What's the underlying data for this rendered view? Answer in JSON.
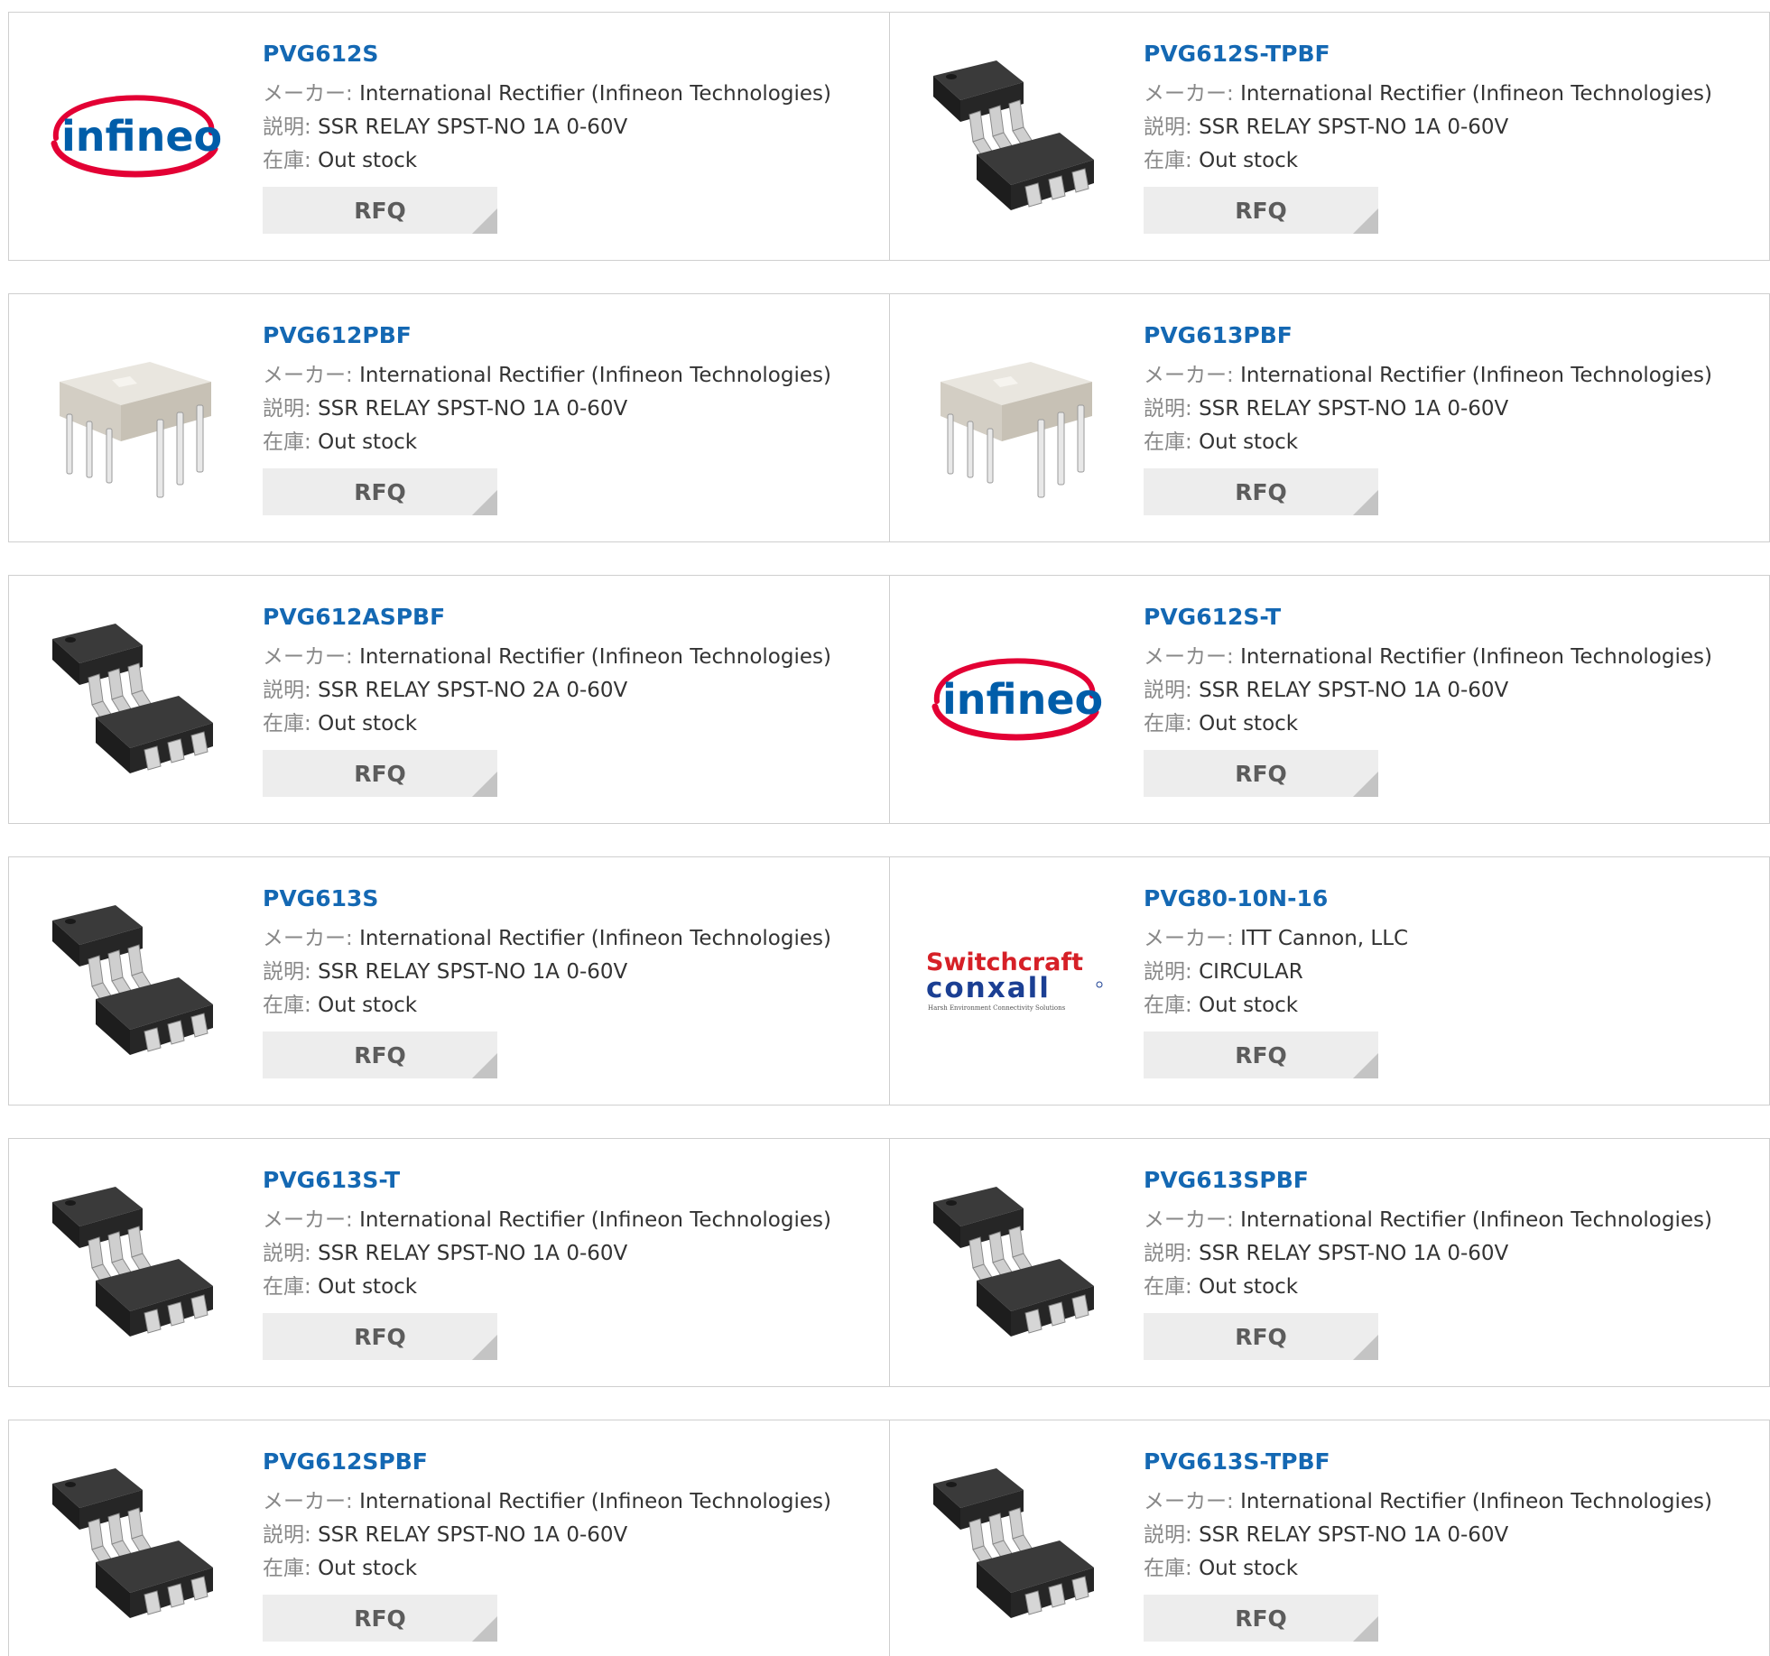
{
  "labels": {
    "maker": "メーカー:",
    "desc": "説明:",
    "stock": "在庫:"
  },
  "rows": [
    [
      {
        "part": "PVG612S",
        "maker": "International Rectifier (Infineon Technologies)",
        "desc": "SSR RELAY SPST-NO 1A 0-60V",
        "stock": "Out stock",
        "button": "RFQ",
        "image": "infineon-logo",
        "logo_text": "infineon"
      },
      {
        "part": "PVG612S-TPBF",
        "maker": "International Rectifier (Infineon Technologies)",
        "desc": "SSR RELAY SPST-NO 1A 0-60V",
        "stock": "Out stock",
        "button": "RFQ",
        "image": "smd-chip-photo"
      }
    ],
    [
      {
        "part": "PVG612PBF",
        "maker": "International Rectifier (Infineon Technologies)",
        "desc": "SSR RELAY SPST-NO 1A 0-60V",
        "stock": "Out stock",
        "button": "RFQ",
        "image": "dip-chip-photo"
      },
      {
        "part": "PVG613PBF",
        "maker": "International Rectifier (Infineon Technologies)",
        "desc": "SSR RELAY SPST-NO 1A 0-60V",
        "stock": "Out stock",
        "button": "RFQ",
        "image": "dip-chip-photo"
      }
    ],
    [
      {
        "part": "PVG612ASPBF",
        "maker": "International Rectifier (Infineon Technologies)",
        "desc": "SSR RELAY SPST-NO 2A 0-60V",
        "stock": "Out stock",
        "button": "RFQ",
        "image": "smd-chip-photo"
      },
      {
        "part": "PVG612S-T",
        "maker": "International Rectifier (Infineon Technologies)",
        "desc": "SSR RELAY SPST-NO 1A 0-60V",
        "stock": "Out stock",
        "button": "RFQ",
        "image": "infineon-logo",
        "logo_text": "infineon"
      }
    ],
    [
      {
        "part": "PVG613S",
        "maker": "International Rectifier (Infineon Technologies)",
        "desc": "SSR RELAY SPST-NO 1A 0-60V",
        "stock": "Out stock",
        "button": "RFQ",
        "image": "smd-chip-photo"
      },
      {
        "part": "PVG80-10N-16",
        "maker": "ITT Cannon, LLC",
        "desc": "CIRCULAR",
        "stock": "Out stock",
        "button": "RFQ",
        "image": "switchcraft-conxall-logo",
        "logo_text": "Switchcraft",
        "logo_text2": "conxall",
        "logo_text3": "Harsh Environment Connectivity Solutions"
      }
    ],
    [
      {
        "part": "PVG613S-T",
        "maker": "International Rectifier (Infineon Technologies)",
        "desc": "SSR RELAY SPST-NO 1A 0-60V",
        "stock": "Out stock",
        "button": "RFQ",
        "image": "smd-chip-photo"
      },
      {
        "part": "PVG613SPBF",
        "maker": "International Rectifier (Infineon Technologies)",
        "desc": "SSR RELAY SPST-NO 1A 0-60V",
        "stock": "Out stock",
        "button": "RFQ",
        "image": "smd-chip-photo"
      }
    ],
    [
      {
        "part": "PVG612SPBF",
        "maker": "International Rectifier (Infineon Technologies)",
        "desc": "SSR RELAY SPST-NO 1A 0-60V",
        "stock": "Out stock",
        "button": "RFQ",
        "image": "smd-chip-photo"
      },
      {
        "part": "PVG613S-TPBF",
        "maker": "International Rectifier (Infineon Technologies)",
        "desc": "SSR RELAY SPST-NO 1A 0-60V",
        "stock": "Out stock",
        "button": "RFQ",
        "image": "smd-chip-photo"
      }
    ]
  ],
  "colors": {
    "link": "#1468b3",
    "label": "#888888",
    "text": "#333333",
    "button_bg": "#ededed",
    "border": "#cfcfcf",
    "infineon_red": "#e30034",
    "infineon_blue": "#005da9"
  }
}
